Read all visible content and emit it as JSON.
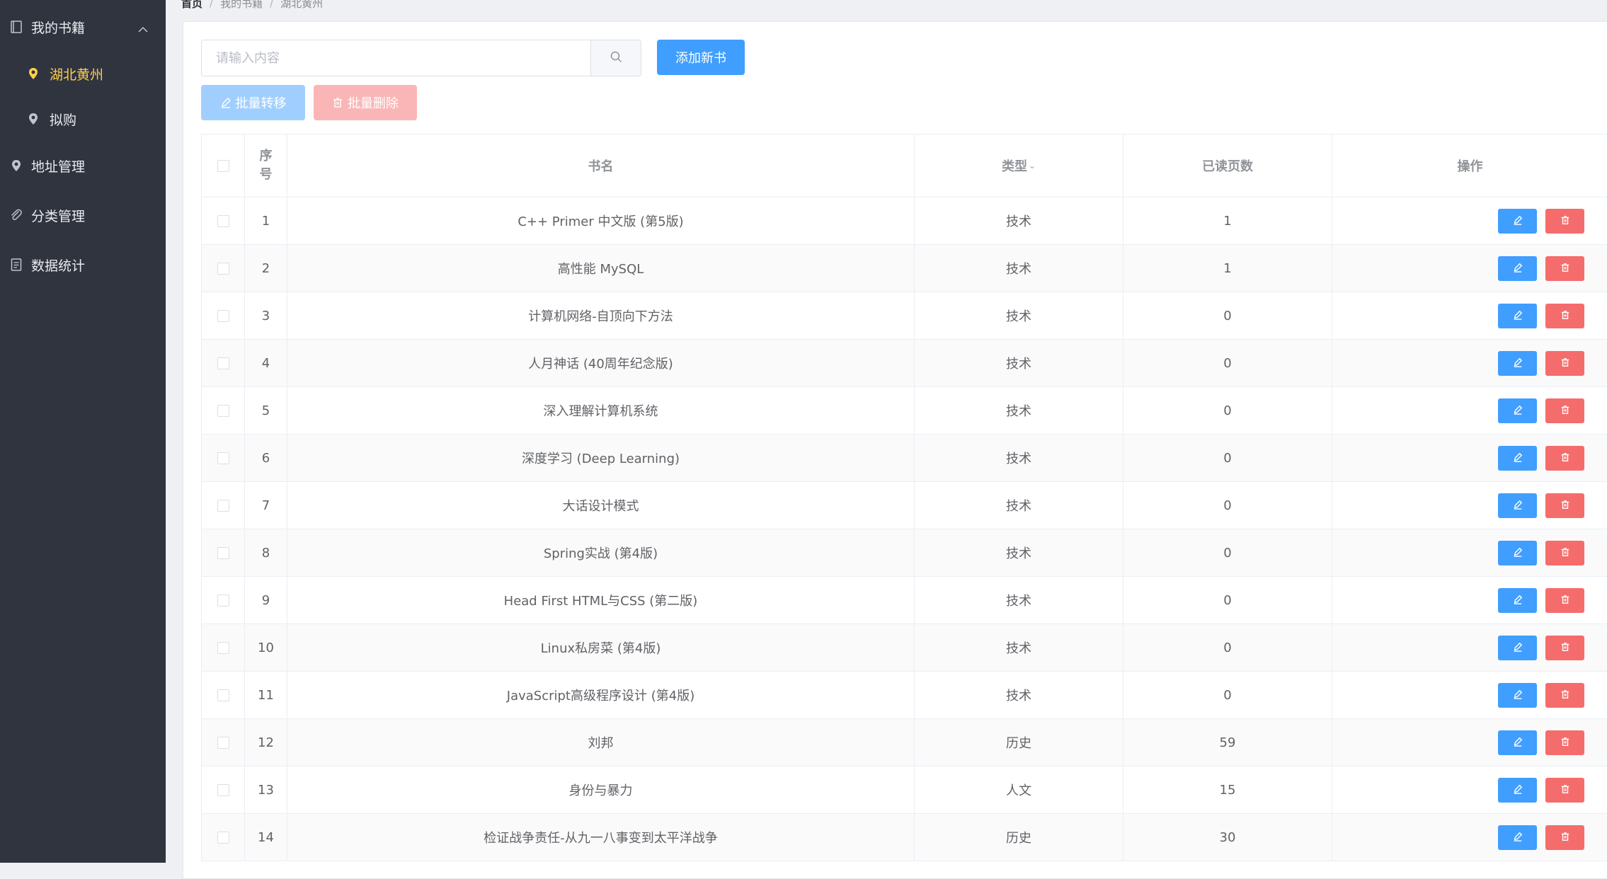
{
  "sidebar": {
    "items": [
      {
        "label": "我的书籍",
        "icon": "book-icon"
      },
      {
        "label": "湖北黄州",
        "icon": "location-icon"
      },
      {
        "label": "拟购",
        "icon": "location-icon"
      },
      {
        "label": "地址管理",
        "icon": "location-icon"
      },
      {
        "label": "分类管理",
        "icon": "paperclip-icon"
      },
      {
        "label": "数据统计",
        "icon": "document-icon"
      }
    ],
    "active_color": "#ffd04b"
  },
  "breadcrumb": [
    "首页",
    "我的书籍",
    "湖北黄州"
  ],
  "toolbar": {
    "search_placeholder": "请输入内容",
    "add_label": "添加新书",
    "batch_move_label": "批量转移",
    "batch_delete_label": "批量删除"
  },
  "table": {
    "headers": {
      "index_1": "序",
      "index_2": "号",
      "name": "书名",
      "type": "类型",
      "read": "已读页数",
      "op": "操作"
    },
    "rows": [
      {
        "idx": "1",
        "name": "C++ Primer 中文版 (第5版)",
        "type": "技术",
        "read": "1"
      },
      {
        "idx": "2",
        "name": "高性能 MySQL",
        "type": "技术",
        "read": "1"
      },
      {
        "idx": "3",
        "name": "计算机网络-自顶向下方法",
        "type": "技术",
        "read": "0"
      },
      {
        "idx": "4",
        "name": "人月神话 (40周年纪念版)",
        "type": "技术",
        "read": "0"
      },
      {
        "idx": "5",
        "name": "深入理解计算机系统",
        "type": "技术",
        "read": "0"
      },
      {
        "idx": "6",
        "name": "深度学习 (Deep Learning)",
        "type": "技术",
        "read": "0"
      },
      {
        "idx": "7",
        "name": "大话设计模式",
        "type": "技术",
        "read": "0"
      },
      {
        "idx": "8",
        "name": "Spring实战 (第4版)",
        "type": "技术",
        "read": "0"
      },
      {
        "idx": "9",
        "name": "Head First HTML与CSS (第二版)",
        "type": "技术",
        "read": "0"
      },
      {
        "idx": "10",
        "name": "Linux私房菜 (第4版)",
        "type": "技术",
        "read": "0"
      },
      {
        "idx": "11",
        "name": "JavaScript高级程序设计 (第4版)",
        "type": "技术",
        "read": "0"
      },
      {
        "idx": "12",
        "name": "刘邦",
        "type": "历史",
        "read": "59"
      },
      {
        "idx": "13",
        "name": "身份与暴力",
        "type": "人文",
        "read": "15"
      },
      {
        "idx": "14",
        "name": "检证战争责任-从九一八事变到太平洋战争",
        "type": "历史",
        "read": "30"
      }
    ]
  },
  "colors": {
    "primary": "#409eff",
    "danger": "#f56c6c",
    "sidebar_bg": "#30343f"
  }
}
